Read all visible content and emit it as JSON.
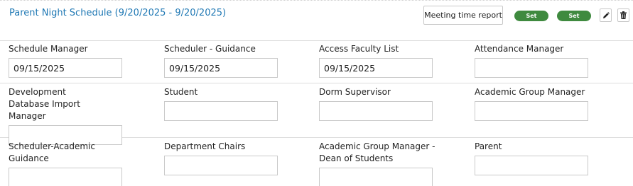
{
  "header": {
    "title": "Parent Night Schedule (9/20/2025 - 9/20/2025)",
    "report_button": "Meeting time report",
    "set_buttons": [
      "Set",
      "Set"
    ],
    "edit_icon": "pencil-icon",
    "delete_icon": "trash-icon"
  },
  "fields": [
    {
      "label": "Schedule Manager",
      "value": "09/15/2025"
    },
    {
      "label": "Scheduler - Guidance",
      "value": "09/15/2025"
    },
    {
      "label": "Access Faculty List",
      "value": "09/15/2025"
    },
    {
      "label": "Attendance Manager",
      "value": ""
    },
    {
      "label": "Development Database Import Manager",
      "value": ""
    },
    {
      "label": "Student",
      "value": ""
    },
    {
      "label": "Dorm Supervisor",
      "value": ""
    },
    {
      "label": "Academic Group Manager",
      "value": ""
    },
    {
      "label": "Scheduler-Academic Guidance",
      "value": ""
    },
    {
      "label": "Department Chairs",
      "value": ""
    },
    {
      "label": "Academic Group Manager - Dean of Students",
      "value": ""
    },
    {
      "label": "Parent",
      "value": ""
    }
  ],
  "colors": {
    "title_link": "#1f78b4",
    "set_pill": "#3f8a3f"
  }
}
